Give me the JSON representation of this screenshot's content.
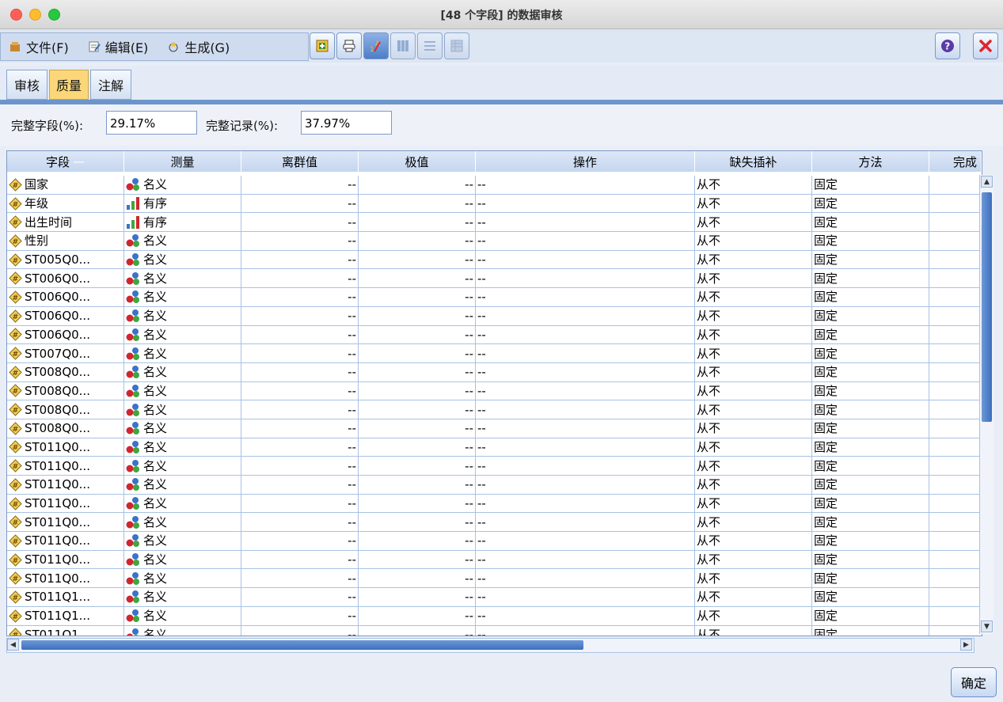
{
  "window": {
    "title": "[48 个字段] 的数据审核"
  },
  "menu": {
    "file": "文件(F)",
    "edit": "编辑(E)",
    "generate": "生成(G)"
  },
  "toolbar": {
    "icons": [
      "export-icon",
      "print-icon",
      "sort-icon",
      "columns-icon",
      "list-icon",
      "table-icon",
      "help-icon",
      "close-icon"
    ]
  },
  "tabs": [
    {
      "label": "审核"
    },
    {
      "label": "质量",
      "selected": true
    },
    {
      "label": "注解"
    }
  ],
  "stats": {
    "complete_fields_label": "完整字段(%):",
    "complete_fields_value": "29.17%",
    "complete_records_label": "完整记录(%):",
    "complete_records_value": "37.97%"
  },
  "table": {
    "columns": [
      "字段",
      "测量",
      "离群值",
      "极值",
      "操作",
      "缺失插补",
      "方法",
      "完成"
    ],
    "rows": [
      {
        "field": "国家",
        "measure": "名义",
        "measure_type": "nominal",
        "outliers": "--",
        "extremes": "--",
        "action": "--",
        "impute": "从不",
        "method": "固定"
      },
      {
        "field": "年级",
        "measure": "有序",
        "measure_type": "ordinal",
        "outliers": "--",
        "extremes": "--",
        "action": "--",
        "impute": "从不",
        "method": "固定"
      },
      {
        "field": "出生时间",
        "measure": "有序",
        "measure_type": "ordinal",
        "outliers": "--",
        "extremes": "--",
        "action": "--",
        "impute": "从不",
        "method": "固定"
      },
      {
        "field": "性别",
        "measure": "名义",
        "measure_type": "nominal",
        "outliers": "--",
        "extremes": "--",
        "action": "--",
        "impute": "从不",
        "method": "固定"
      },
      {
        "field": "ST005Q0...",
        "measure": "名义",
        "measure_type": "nominal",
        "outliers": "--",
        "extremes": "--",
        "action": "--",
        "impute": "从不",
        "method": "固定"
      },
      {
        "field": "ST006Q0...",
        "measure": "名义",
        "measure_type": "nominal",
        "outliers": "--",
        "extremes": "--",
        "action": "--",
        "impute": "从不",
        "method": "固定"
      },
      {
        "field": "ST006Q0...",
        "measure": "名义",
        "measure_type": "nominal",
        "outliers": "--",
        "extremes": "--",
        "action": "--",
        "impute": "从不",
        "method": "固定"
      },
      {
        "field": "ST006Q0...",
        "measure": "名义",
        "measure_type": "nominal",
        "outliers": "--",
        "extremes": "--",
        "action": "--",
        "impute": "从不",
        "method": "固定"
      },
      {
        "field": "ST006Q0...",
        "measure": "名义",
        "measure_type": "nominal",
        "outliers": "--",
        "extremes": "--",
        "action": "--",
        "impute": "从不",
        "method": "固定"
      },
      {
        "field": "ST007Q0...",
        "measure": "名义",
        "measure_type": "nominal",
        "outliers": "--",
        "extremes": "--",
        "action": "--",
        "impute": "从不",
        "method": "固定"
      },
      {
        "field": "ST008Q0...",
        "measure": "名义",
        "measure_type": "nominal",
        "outliers": "--",
        "extremes": "--",
        "action": "--",
        "impute": "从不",
        "method": "固定"
      },
      {
        "field": "ST008Q0...",
        "measure": "名义",
        "measure_type": "nominal",
        "outliers": "--",
        "extremes": "--",
        "action": "--",
        "impute": "从不",
        "method": "固定"
      },
      {
        "field": "ST008Q0...",
        "measure": "名义",
        "measure_type": "nominal",
        "outliers": "--",
        "extremes": "--",
        "action": "--",
        "impute": "从不",
        "method": "固定"
      },
      {
        "field": "ST008Q0...",
        "measure": "名义",
        "measure_type": "nominal",
        "outliers": "--",
        "extremes": "--",
        "action": "--",
        "impute": "从不",
        "method": "固定"
      },
      {
        "field": "ST011Q0...",
        "measure": "名义",
        "measure_type": "nominal",
        "outliers": "--",
        "extremes": "--",
        "action": "--",
        "impute": "从不",
        "method": "固定"
      },
      {
        "field": "ST011Q0...",
        "measure": "名义",
        "measure_type": "nominal",
        "outliers": "--",
        "extremes": "--",
        "action": "--",
        "impute": "从不",
        "method": "固定"
      },
      {
        "field": "ST011Q0...",
        "measure": "名义",
        "measure_type": "nominal",
        "outliers": "--",
        "extremes": "--",
        "action": "--",
        "impute": "从不",
        "method": "固定"
      },
      {
        "field": "ST011Q0...",
        "measure": "名义",
        "measure_type": "nominal",
        "outliers": "--",
        "extremes": "--",
        "action": "--",
        "impute": "从不",
        "method": "固定"
      },
      {
        "field": "ST011Q0...",
        "measure": "名义",
        "measure_type": "nominal",
        "outliers": "--",
        "extremes": "--",
        "action": "--",
        "impute": "从不",
        "method": "固定"
      },
      {
        "field": "ST011Q0...",
        "measure": "名义",
        "measure_type": "nominal",
        "outliers": "--",
        "extremes": "--",
        "action": "--",
        "impute": "从不",
        "method": "固定"
      },
      {
        "field": "ST011Q0...",
        "measure": "名义",
        "measure_type": "nominal",
        "outliers": "--",
        "extremes": "--",
        "action": "--",
        "impute": "从不",
        "method": "固定"
      },
      {
        "field": "ST011Q0...",
        "measure": "名义",
        "measure_type": "nominal",
        "outliers": "--",
        "extremes": "--",
        "action": "--",
        "impute": "从不",
        "method": "固定"
      },
      {
        "field": "ST011Q1...",
        "measure": "名义",
        "measure_type": "nominal",
        "outliers": "--",
        "extremes": "--",
        "action": "--",
        "impute": "从不",
        "method": "固定"
      },
      {
        "field": "ST011Q1...",
        "measure": "名义",
        "measure_type": "nominal",
        "outliers": "--",
        "extremes": "--",
        "action": "--",
        "impute": "从不",
        "method": "固定"
      },
      {
        "field": "ST011Q1...",
        "measure": "名义",
        "measure_type": "nominal",
        "outliers": "--",
        "extremes": "--",
        "action": "--",
        "impute": "从不",
        "method": "固定"
      }
    ]
  },
  "footer": {
    "ok_label": "确定"
  }
}
